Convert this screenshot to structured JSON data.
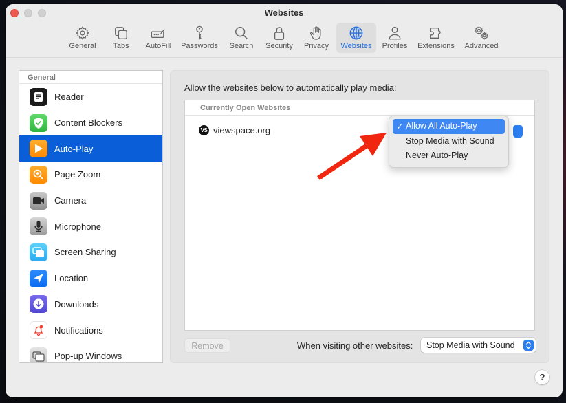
{
  "window": {
    "title": "Websites"
  },
  "toolbar": {
    "items": [
      {
        "label": "General",
        "icon": "gear-icon"
      },
      {
        "label": "Tabs",
        "icon": "tabs-icon"
      },
      {
        "label": "AutoFill",
        "icon": "autofill-icon"
      },
      {
        "label": "Passwords",
        "icon": "key-icon"
      },
      {
        "label": "Search",
        "icon": "search-icon"
      },
      {
        "label": "Security",
        "icon": "lock-icon"
      },
      {
        "label": "Privacy",
        "icon": "hand-icon"
      },
      {
        "label": "Websites",
        "icon": "globe-icon",
        "active": true
      },
      {
        "label": "Profiles",
        "icon": "person-icon"
      },
      {
        "label": "Extensions",
        "icon": "puzzle-icon"
      },
      {
        "label": "Advanced",
        "icon": "gears-icon"
      }
    ]
  },
  "sidebar": {
    "section_header": "General",
    "items": [
      {
        "label": "Reader",
        "icon": "reader-icon"
      },
      {
        "label": "Content Blockers",
        "icon": "shield-check-icon"
      },
      {
        "label": "Auto-Play",
        "icon": "play-icon",
        "active": true
      },
      {
        "label": "Page Zoom",
        "icon": "zoom-icon"
      },
      {
        "label": "Camera",
        "icon": "camera-icon"
      },
      {
        "label": "Microphone",
        "icon": "microphone-icon"
      },
      {
        "label": "Screen Sharing",
        "icon": "screen-sharing-icon"
      },
      {
        "label": "Location",
        "icon": "location-icon"
      },
      {
        "label": "Downloads",
        "icon": "download-icon"
      },
      {
        "label": "Notifications",
        "icon": "bell-icon"
      },
      {
        "label": "Pop-up Windows",
        "icon": "popup-windows-icon"
      }
    ]
  },
  "panel": {
    "description": "Allow the websites below to automatically play media:",
    "list_header": "Currently Open Websites",
    "sites": [
      {
        "favicon_text": "VS",
        "domain": "viewspace.org",
        "setting": "Allow All Auto-Play"
      }
    ],
    "dropdown_menu": {
      "options": [
        "Allow All Auto-Play",
        "Stop Media with Sound",
        "Never Auto-Play"
      ],
      "selected": "Allow All Auto-Play",
      "check_mark": "✓"
    },
    "remove_button": "Remove",
    "other_websites_label": "When visiting other websites:",
    "other_websites_value": "Stop Media with Sound"
  },
  "help_button": "?",
  "colors": {
    "accent": "#0a5fd8",
    "menu_highlight": "#3f87f2",
    "annotation_arrow": "#f0260f"
  }
}
